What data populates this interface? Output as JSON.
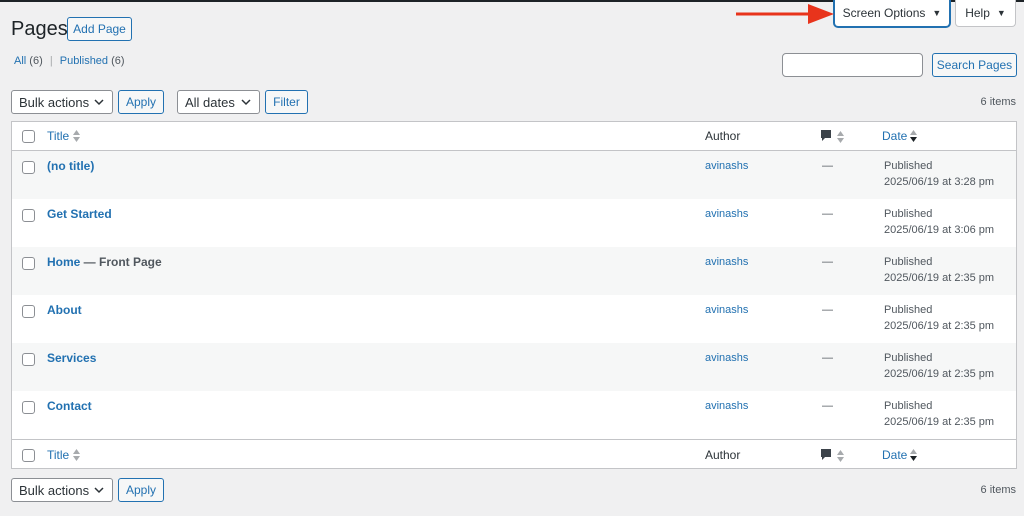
{
  "header": {
    "title": "Pages",
    "add_button": "Add Page",
    "screen_options": "Screen Options",
    "help": "Help"
  },
  "filters": {
    "all_label": "All",
    "all_count": "(6)",
    "published_label": "Published",
    "published_count": "(6)",
    "separator": "|"
  },
  "search": {
    "button": "Search Pages",
    "value": ""
  },
  "bulk": {
    "label": "Bulk actions",
    "apply": "Apply"
  },
  "dates": {
    "label": "All dates",
    "filter": "Filter"
  },
  "items_count": "6 items",
  "columns": {
    "title": "Title",
    "author": "Author",
    "date": "Date"
  },
  "rows": [
    {
      "title": "(no title)",
      "state": "",
      "author": "avinashs",
      "comments": "—",
      "status": "Published",
      "date": "2025/06/19 at 3:28 pm"
    },
    {
      "title": "Get Started",
      "state": "",
      "author": "avinashs",
      "comments": "—",
      "status": "Published",
      "date": "2025/06/19 at 3:06 pm"
    },
    {
      "title": "Home",
      "state": " — Front Page",
      "author": "avinashs",
      "comments": "—",
      "status": "Published",
      "date": "2025/06/19 at 2:35 pm"
    },
    {
      "title": "About",
      "state": "",
      "author": "avinashs",
      "comments": "—",
      "status": "Published",
      "date": "2025/06/19 at 2:35 pm"
    },
    {
      "title": "Services",
      "state": "",
      "author": "avinashs",
      "comments": "—",
      "status": "Published",
      "date": "2025/06/19 at 2:35 pm"
    },
    {
      "title": "Contact",
      "state": "",
      "author": "avinashs",
      "comments": "—",
      "status": "Published",
      "date": "2025/06/19 at 2:35 pm"
    }
  ],
  "colors": {
    "accent": "#2271b1",
    "annotation_arrow": "#e8341c",
    "background": "#f0f0f1"
  },
  "icons": {
    "comments": "speech-bubble-icon",
    "sort": "sort-arrows-icon",
    "arrow": "red-arrow-annotation"
  }
}
